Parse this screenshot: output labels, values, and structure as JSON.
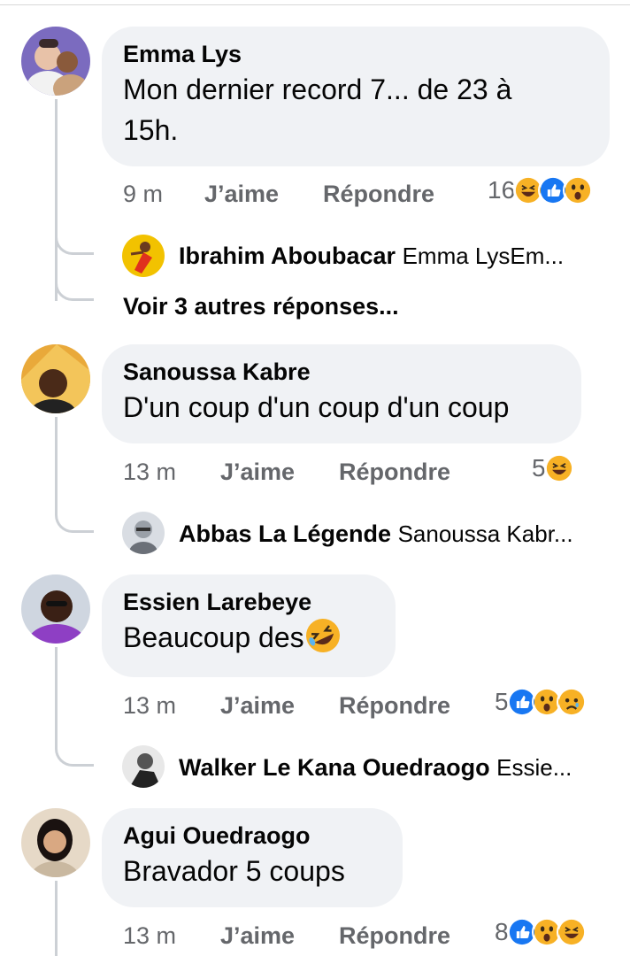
{
  "comments": [
    {
      "author": "Emma Lys",
      "text_line1": "Mon dernier record 7... de 23 à",
      "text_line2": "15h.",
      "time": "9 m",
      "like_label": "J’aime",
      "reply_label": "Répondre",
      "reaction_count": "16",
      "reactions": [
        "haha-emoji",
        "like-emoji",
        "wow-emoji"
      ],
      "reply": {
        "author": "Ibrahim Aboubacar",
        "text": "Emma LysEm..."
      },
      "more_replies": "Voir 3 autres réponses..."
    },
    {
      "author": "Sanoussa Kabre",
      "text": "D'un coup d'un coup d'un coup",
      "time": "13 m",
      "like_label": "J’aime",
      "reply_label": "Répondre",
      "reaction_count": "5",
      "reactions": [
        "haha-emoji"
      ],
      "reply": {
        "author": "Abbas La Légende",
        "text": "Sanoussa Kabr..."
      }
    },
    {
      "author": "Essien Larebeye",
      "text": "Beaucoup des",
      "time": "13 m",
      "like_label": "J’aime",
      "reply_label": "Répondre",
      "reaction_count": "5",
      "reactions": [
        "like-emoji",
        "wow-emoji",
        "sad-emoji"
      ],
      "reply": {
        "author": "Walker Le Kana Ouedraogo",
        "text": "Essie..."
      }
    },
    {
      "author": "Agui Ouedraogo",
      "text": "Bravador 5 coups",
      "time": "13 m",
      "like_label": "J’aime",
      "reply_label": "Répondre",
      "reaction_count": "8",
      "reactions": [
        "like-emoji",
        "wow-emoji",
        "haha-emoji"
      ]
    }
  ],
  "colors": {
    "bubble": "#f0f2f5",
    "meta_text": "#65676b",
    "like_blue": "#1877f2",
    "emoji_yellow": "#f7b125",
    "thread_line": "#ccd0d5"
  }
}
